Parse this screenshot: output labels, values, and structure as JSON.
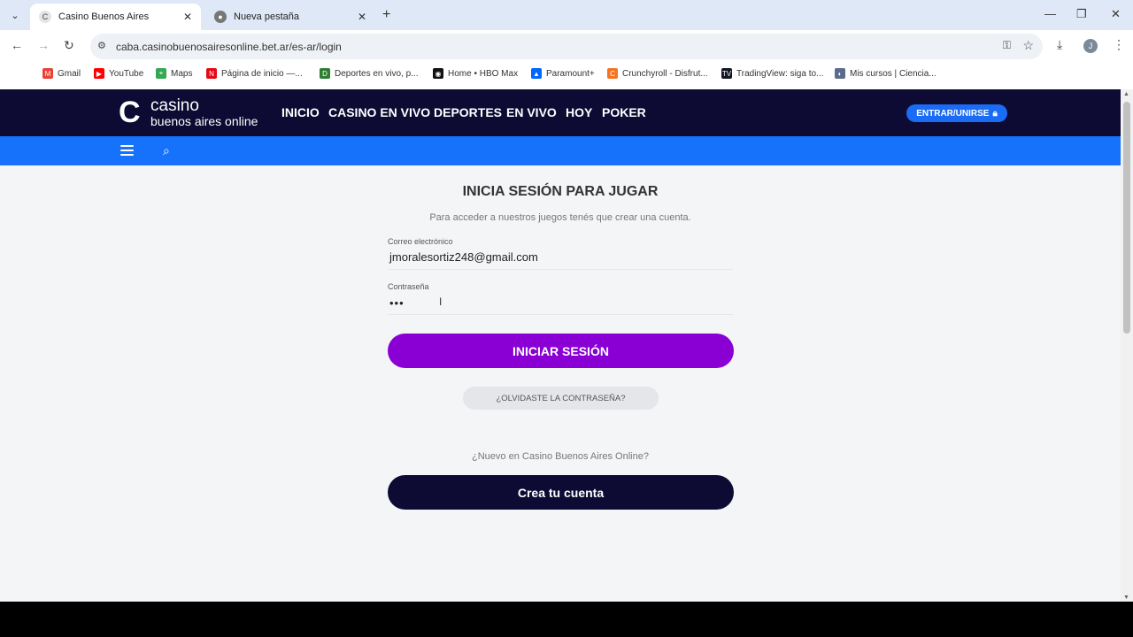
{
  "browser": {
    "tabs": [
      {
        "title": "Casino Buenos Aires",
        "active": true
      },
      {
        "title": "Nueva pestaña",
        "active": false
      }
    ],
    "url": "caba.casinobuenosairesonline.bet.ar/es-ar/login",
    "avatar_letter": "J",
    "bookmarks": [
      {
        "label": "Gmail",
        "icon": "gmail-icon",
        "color": "#ea4335"
      },
      {
        "label": "YouTube",
        "icon": "youtube-icon",
        "color": "#ff0000"
      },
      {
        "label": "Maps",
        "icon": "maps-icon",
        "color": "#34a853"
      },
      {
        "label": "Página de inicio —...",
        "icon": "netflix-icon",
        "color": "#e50914"
      },
      {
        "label": "Deportes en vivo, p...",
        "icon": "espn-icon",
        "color": "#2e7d32"
      },
      {
        "label": "Home • HBO Max",
        "icon": "hbo-icon",
        "color": "#111111"
      },
      {
        "label": "Paramount+",
        "icon": "paramount-icon",
        "color": "#0064ff"
      },
      {
        "label": "Crunchyroll - Disfrut...",
        "icon": "crunchyroll-icon",
        "color": "#f47521"
      },
      {
        "label": "TradingView: siga to...",
        "icon": "tradingview-icon",
        "color": "#131722"
      },
      {
        "label": "Mis cursos | Ciencia...",
        "icon": "courses-icon",
        "color": "#5a6b8c"
      }
    ]
  },
  "site": {
    "logo_line1": "casino",
    "logo_line2": "buenos aires online",
    "nav": [
      "INICIO",
      "CASINO EN VIVO",
      "DEPORTES",
      "EN VIVO",
      "HOY",
      "POKER"
    ],
    "login_button": "ENTRAR/UNIRSE",
    "colors": {
      "header": "#0d0b33",
      "subbar": "#1672fa",
      "primary": "#8a00d4"
    }
  },
  "form": {
    "title": "INICIA SESIÓN PARA JUGAR",
    "subtitle": "Para acceder a nuestros juegos tenés que crear una cuenta.",
    "email_label": "Correo electrónico",
    "email_value": "jmoralesortiz248@gmail.com",
    "password_label": "Contraseña",
    "password_value": "•••",
    "submit": "INICIAR SESIÓN",
    "forgot": "¿OLVIDASTE LA CONTRASEÑA?",
    "new_prompt": "¿Nuevo en Casino Buenos Aires Online?",
    "create": "Crea tu cuenta"
  }
}
